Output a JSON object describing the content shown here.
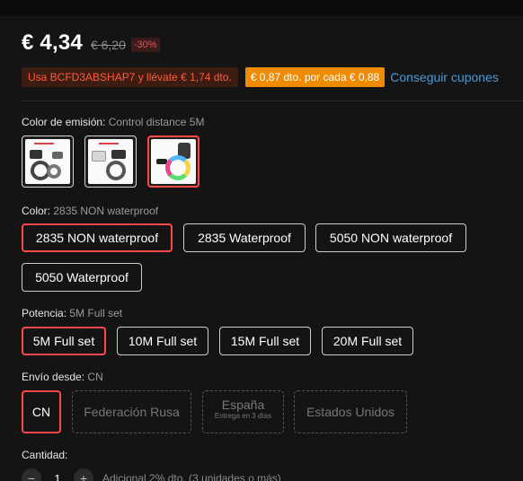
{
  "price": {
    "current": "€ 4,34",
    "original": "€ 6,20",
    "discount": "-30%"
  },
  "coupons": {
    "code_offer": "Usa BCFD3ABSHAP7 y llévate € 1,74 dto.",
    "store_offer": "€ 0,87 dto. por cada € 0,88",
    "get_link": "Conseguir cupones"
  },
  "emission_color": {
    "label": "Color de emisión:",
    "value": "Control distance 5M",
    "thumbs": [
      "control-distance-kit-1",
      "control-distance-kit-2",
      "control-distance-5m"
    ]
  },
  "color": {
    "label": "Color:",
    "value": "2835 NON waterproof",
    "options": [
      "2835 NON waterproof",
      "2835 Waterproof",
      "5050 NON waterproof",
      "5050 Waterproof"
    ]
  },
  "power": {
    "label": "Potencia:",
    "value": "5M Full set",
    "options": [
      "5M Full set",
      "10M Full set",
      "15M Full set",
      "20M Full set"
    ]
  },
  "ship_from": {
    "label": "Envío desde:",
    "value": "CN",
    "options": [
      "CN",
      "Federación Rusa",
      "España",
      "Estados Unidos"
    ],
    "spain_note": "Entrega en 3 días"
  },
  "quantity": {
    "label": "Cantidad:",
    "minus": "−",
    "value": "1",
    "plus": "+",
    "note": "Adicional 2% dto. (3 unidades o más)"
  },
  "colors": {
    "accent_red": "#ff4747",
    "coupon_orange": "#f08a00",
    "link_blue": "#4a9bd8",
    "background": "#141414"
  }
}
